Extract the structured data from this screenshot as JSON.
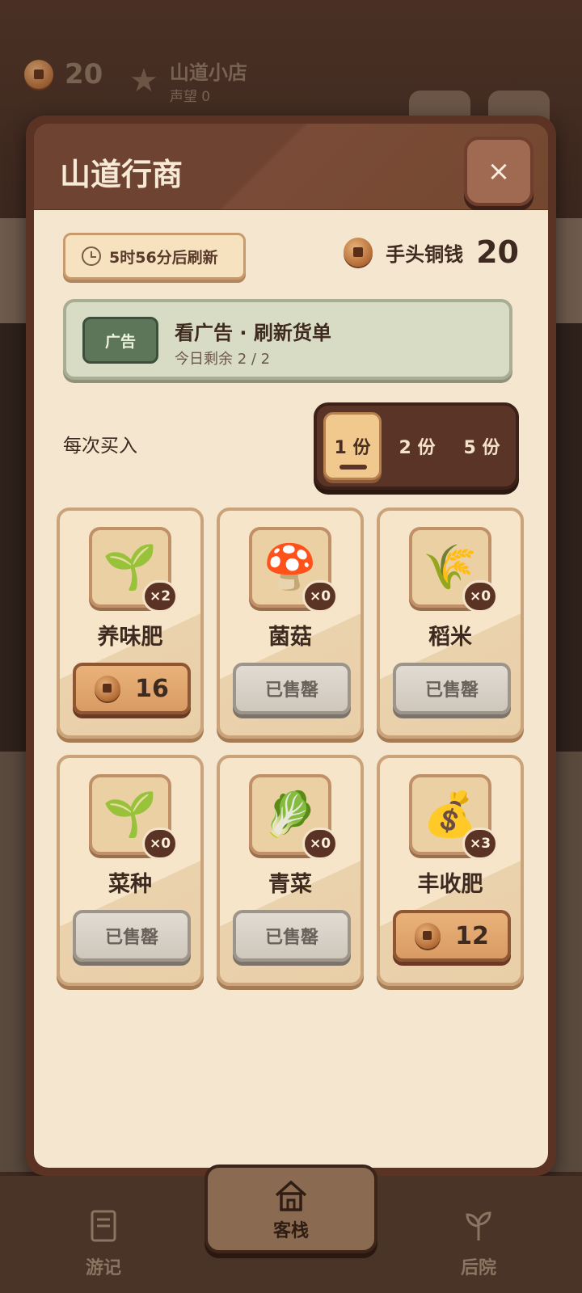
{
  "background": {
    "coins": "20",
    "shop_name": "山道小店",
    "reputation": "声望 0"
  },
  "modal": {
    "title": "山道行商",
    "close_icon": "×",
    "refresh_text": "5时56分后刷新",
    "wallet_label": "手头铜钱",
    "wallet_value": "20",
    "ad": {
      "badge": "广告",
      "title": "看广告 · 刷新货单",
      "remaining": "今日剩余 2 / 2"
    },
    "quantity_label": "每次买入",
    "quantity_options": [
      "1 份",
      "2 份",
      "5 份"
    ],
    "quantity_selected": "1 份",
    "items": [
      {
        "name": "养味肥",
        "icon": "🌱",
        "count": "×2",
        "status": "price",
        "price": "16"
      },
      {
        "name": "菌菇",
        "icon": "🍄",
        "count": "×0",
        "status": "sold",
        "sold_label": "已售罄"
      },
      {
        "name": "稻米",
        "icon": "🌾",
        "count": "×0",
        "status": "sold",
        "sold_label": "已售罄"
      },
      {
        "name": "菜种",
        "icon": "🌱",
        "count": "×0",
        "status": "sold",
        "sold_label": "已售罄"
      },
      {
        "name": "青菜",
        "icon": "🥬",
        "count": "×0",
        "status": "sold",
        "sold_label": "已售罄"
      },
      {
        "name": "丰收肥",
        "icon": "💰",
        "count": "×3",
        "status": "price",
        "price": "12"
      }
    ]
  },
  "nav": {
    "items": [
      {
        "label": "游记",
        "icon": "book-icon"
      },
      {
        "label": "客栈",
        "icon": "house-icon"
      },
      {
        "label": "后院",
        "icon": "sprout-icon"
      }
    ]
  },
  "colors": {
    "modal_frame": "#5a3325",
    "modal_body": "#f5e7cf",
    "accent_price": "#d99b63",
    "ad_green": "#5d765a"
  }
}
